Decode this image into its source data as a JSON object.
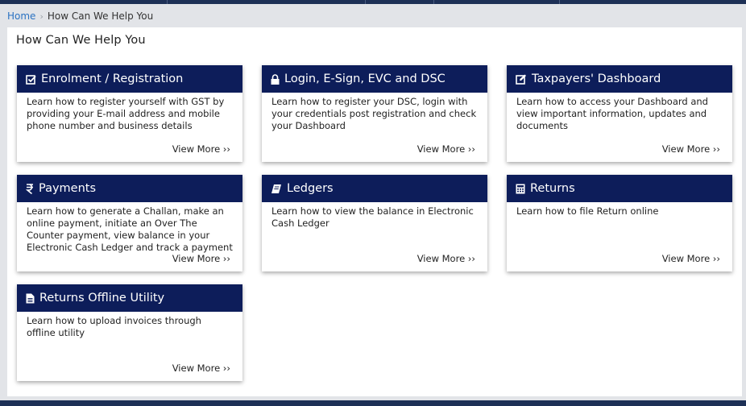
{
  "breadcrumb": {
    "home": "Home",
    "separator": "›",
    "current": "How Can We Help You"
  },
  "page": {
    "title": "How Can We Help You"
  },
  "cards": [
    {
      "icon": "checkbox-edit-icon",
      "title": "Enrolment / Registration",
      "desc": "Learn how to register yourself with GST by providing your E-mail address and mobile phone number and business details",
      "link": "View More ››"
    },
    {
      "icon": "lock-icon",
      "title": "Login, E-Sign, EVC and DSC",
      "desc": "Learn how to register your DSC, login with your credentials post registration and check your Dashboard",
      "link": "View More ››"
    },
    {
      "icon": "edit-icon",
      "title": "Taxpayers' Dashboard",
      "desc": "Learn how to access your Dashboard and view important information, updates and documents",
      "link": "View More ››"
    },
    {
      "icon": "rupee-icon",
      "title": "Payments",
      "desc": "Learn how to generate a Challan, make an online payment, initiate an Over The Counter payment, view balance in your Electronic Cash Ledger and track a payment",
      "link": "View More ››"
    },
    {
      "icon": "book-icon",
      "title": "Ledgers",
      "desc": "Learn how to view the balance in Electronic Cash Ledger",
      "link": "View More ››"
    },
    {
      "icon": "calculator-icon",
      "title": "Returns",
      "desc": "Learn how to file Return online",
      "link": "View More ››"
    },
    {
      "icon": "file-icon",
      "title": "Returns Offline Utility",
      "desc": "Learn how to upload invoices through offline utility",
      "link": "View More ››"
    }
  ],
  "colors": {
    "header": "#0d1d5a",
    "topbar": "#1d3056",
    "link": "#2b72c2",
    "background": "#e2e4e8"
  }
}
